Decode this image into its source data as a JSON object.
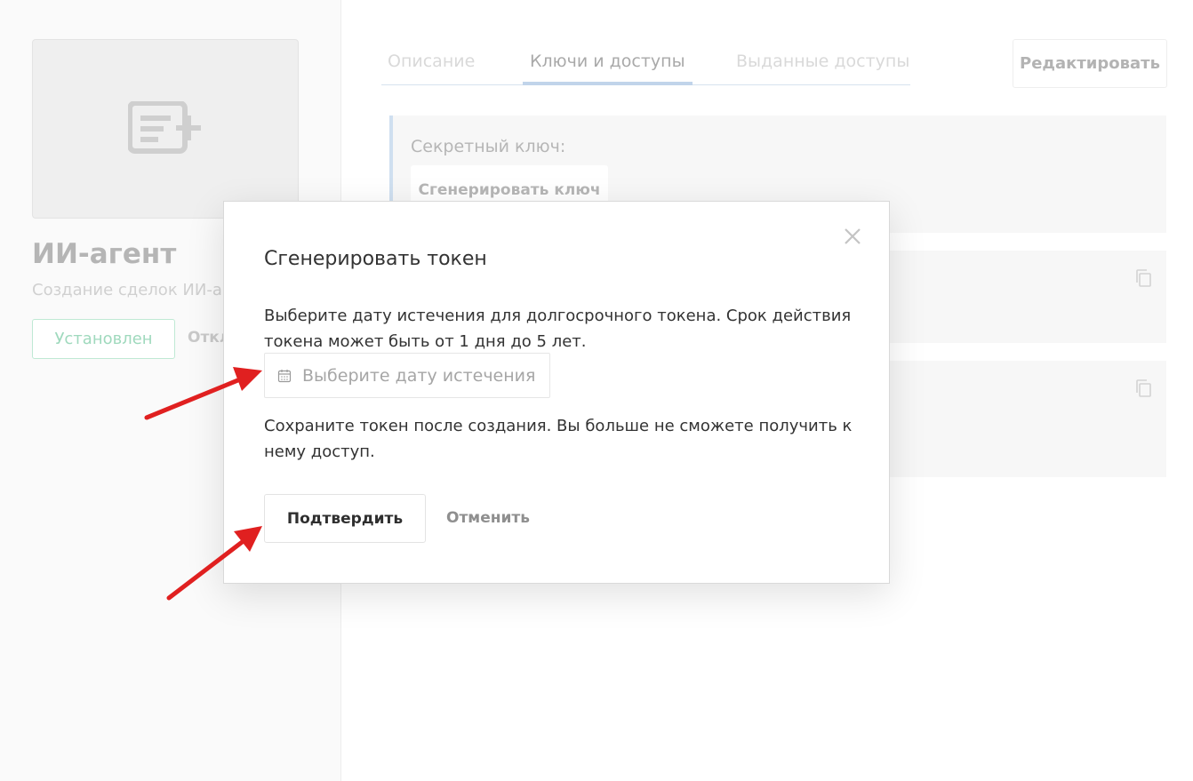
{
  "app": {
    "title": "ИИ-агент",
    "subtitle": "Создание сделок ИИ-агентом",
    "installed_label": "Установлен",
    "disable_label": "Отключить",
    "cover_icon": "add-list-icon"
  },
  "tabs": [
    {
      "label": "Описание",
      "active": false
    },
    {
      "label": "Ключи и доступы",
      "active": true
    },
    {
      "label": "Выданные доступы",
      "active": false
    }
  ],
  "edit_label": "Редактировать",
  "secret": {
    "label": "Секретный ключ:",
    "generate_label": "Сгенерировать ключ"
  },
  "copy_icon": "copy-icon",
  "modal": {
    "title": "Сгенерировать токен",
    "description": "Выберите дату истечения для долгосрочного токена. Срок действия токена может быть от 1 дня до 5 лет.",
    "date_placeholder": "Выберите дату истечения",
    "warning": "Сохраните токен после создания. Вы больше не сможете получить к нему доступ.",
    "confirm_label": "Подтвердить",
    "cancel_label": "Отменить",
    "close_icon": "close-icon",
    "calendar_icon": "calendar-icon"
  },
  "colors": {
    "annotation_arrow": "#e02020",
    "installed_green": "#9fd9bd",
    "tab_accent": "#c1d4ea"
  }
}
